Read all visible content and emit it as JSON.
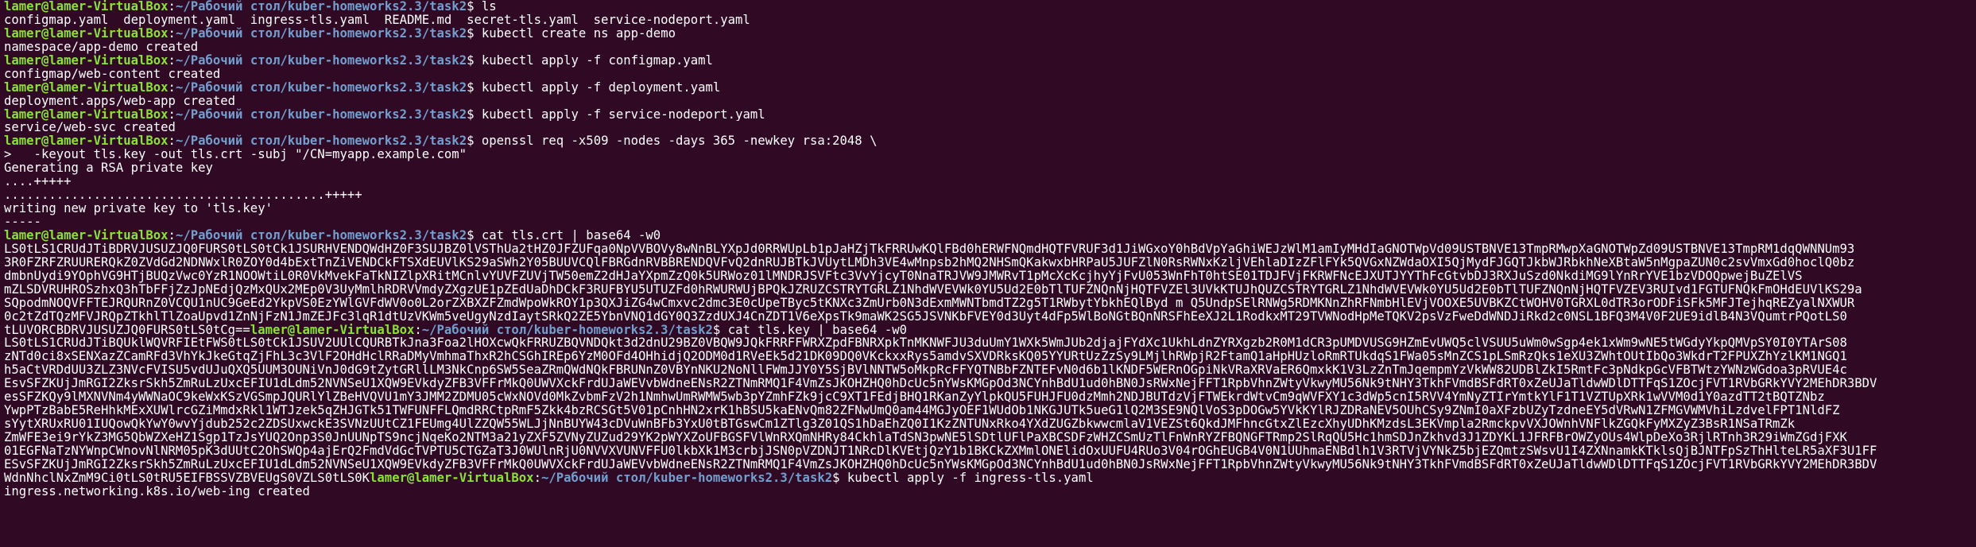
{
  "prompt": {
    "user": "lamer@lamer-VirtualBox",
    "path": "~/Рабочий стол/kuber-homeworks2.3/task2",
    "symbol": "$ "
  },
  "lines": [
    {
      "cmd": "ls"
    },
    {
      "out": "configmap.yaml  deployment.yaml  ingress-tls.yaml  README.md  secret-tls.yaml  service-nodeport.yaml"
    },
    {
      "cmd": "kubectl create ns app-demo"
    },
    {
      "out": "namespace/app-demo created"
    },
    {
      "cmd": "kubectl apply -f configmap.yaml"
    },
    {
      "out": "configmap/web-content created"
    },
    {
      "cmd": "kubectl apply -f deployment.yaml"
    },
    {
      "out": "deployment.apps/web-app created"
    },
    {
      "cmd": "kubectl apply -f service-nodeport.yaml"
    },
    {
      "out": "service/web-svc created"
    },
    {
      "cmd": "openssl req -x509 -nodes -days 365 -newkey rsa:2048 \\"
    },
    {
      "out": ">   -keyout tls.key -out tls.crt -subj \"/CN=myapp.example.com\""
    },
    {
      "out": "Generating a RSA private key"
    },
    {
      "out": "....+++++"
    },
    {
      "out": "...........................................+++++"
    },
    {
      "out": "writing new private key to 'tls.key'"
    },
    {
      "out": "-----"
    },
    {
      "cmd": "cat tls.crt | base64 -w0"
    },
    {
      "out": "LS0tLS1CRUdJTiBDRVJUSUZJQ0FURS0tLS0tCk1JSURHVENDQWdHZ0F3SUJBZ0lVSThUa2tHZ0JFZUFqa0NpVVBOVy8wNnBLYXpJd0RRWUpLb1pJaHZjTkFRRUwKQlFBd0hERWFNQmdHQTFVRUF3d1JiWGxoY0hBdVpYaGhiWEJzWlM1amIyMHdIaGNOTWpVd09USTBNVE13TmpRMwpXaGNOTWpZd09USTBNVE13TmpRM1dqQWNNUm93"
    },
    {
      "out": "3R0FZRFZRUURERQkZ0ZVdGd2NDNWxlR0ZOY0d4bExtTnZiVENDCkFTSXdEUVlKS29aSWh2Y05BUUVCQlFBRGdnRVBBRENDQVFvQ2dnRUJBTkJVUytLMDh3VE4wMnpsb2hMQ2NHSmQKakwxbHRPaU5JUFZlN0RsRWNxKzljVEhlaDIzZFlFYk5QVGxNZWdaOXI5QjMydFJGQTJkbWJRbkhNeXBtaW5nMgpaZUN0c2svVmxGd0hoclQ0bz"
    },
    {
      "out": "dmbnUydi9YOphVG9HTjBUQzVwc0YzR1NOOWtiL0R0VkMvekFaTkNIZlpXRitMCnlvYUVFZUVjTW50emZ2dHJaYXpmZzQ0k5URWoz01lMNDRJSVFtc3VvYjcyT0NnaTRJVW9JMWRvT1pMcXcKcjhyYjFvU053WnFhT0htSE01TDJFVjFKRWFNcEJXUTJYYThFcGtvbDJ3RXJuSzd0NkdiMG9lYnRrYVE1bzVDOQpwejBuZElVS"
    },
    {
      "out": "mZLSDVRUHROSzhxQ3hTbFFjZzJpNEdjQzMxQUx2MEp0V3UyMmlhRDRVVmdyZXgzUE1pZEdUaDhDCkF3RUFBYU5UTUZFd0hRWURWUjBPQkJZRUZCSTRYTGRLZ1NhdWVEVWk0YU5Ud2E0bTlTUFZNQnNjHQTFVZEl3UVkKTUJhQUZCSTRYTGRLZ1NhdWVEVWk0YU5Ud2E0bTlTUFZNQnNjHQTFVZEV3RUIvd1FGTUFNQkFmOHdEUVlKS29a"
    },
    {
      "out": "SQpodmNOQVFFTEJRQURnZ0VCQU1nUC9GeEd2YkpVS0EzYWlGVFdWV0o0L2orZXBXZFZmdWpoWkROY1p3QXJiZG4wCmxvc2dmc3E0cUpeTByc5tKNXc3ZmUrb0N3dExmMWNTbmdTZ2g5T1RWbytYbkhEQlByd m Q5UndpSElRNWg5RDMKNnZhRFNmbHlEVjVOOXE5UVBKZCtWOHV0TGRXL0dTR3orODFiSFk5MFJTejhqREZyalNXWUR"
    },
    {
      "out": "0c2tZdTQzMFVJRQpZTkhlTlZoaUpvd1ZnNjFzN1JmZEJFc3lqR1dtUzVKWm5veUgyNzdIaytSRkQ2ZE5YbnVNQ1dGY0Q3ZzdUXJ4CnZDT1V6eXpsTk9maWK2SG5JSVNKbFVEY0d3Uyt4dFp5WlBoNGtBQnNRSFhEeXJ2L1RodkxMT29TVWNodHpMeTQKV2psVzFweDdWNDJiRkd2c0NSL1BFQ3M4V0F2UE9idlB4N3VQumtrPQotLS0"
    },
    {
      "out": "tLUVORCBDRVJUSUZJQ0FURS0tLS0tCg==",
      "prompt_after": true
    },
    {
      "cmd_inline": "cat tls.key | base64 -w0"
    },
    {
      "out": "LS0tLS1CRUdJTiBQUklWQVRFIEtFWS0tLS0tCk1JSUV2UUlCQURBTkJna3Foa2lHOXcwQkFRRUZBQVNDQkt3d2dnU29BZ0VBQW9JQkFRRFFWRXZpdFBNRXpkTnMKNWFJU3duUmY1WXk5WmJUb2djajFYdXc1UkhLdnZYRXgzb2R0M1dCR3pUMDVUSG9HZmEvUWQ5clVSUU5uWm0wSgp4ek1xWm9wNE5tWGdyYkpQMVpSY0I0YTArS08"
    },
    {
      "out": "zNTd0ci8xSENXazZCamRFd3VhYkJkeGtqZjFhL3c3VlF2OHdHclRRaDMyVmhmaThxR2hCSGhIREp6YzM0OFd4OHhidjQ2ODM0d1RVeEk5d21DK09DQ0VKckxxRys5amdvSXVDRksKQ05YYURtUzZzSy9LMjlhRWpjR2FtamQ1aHpHUzloRmRTUkdqS1FWa05sMnZCS1pLSmRzQks1eXU3ZWhtOUtIbQo3WkdrT2FPUXZhYzlKM1NGQ1"
    },
    {
      "out": "h5aCtVRDdUU3ZLZ3NVcFVISU5vdUJuQXQ5UUM3OUNiVnJ0dG9tZytGRllLM3NkCnp6SW5SeaZRmQWdNQkFBRUNnZ0VBYnNKU2NoNllFWmJJY0Y5SjBVlNNTW5oMkpRcFFYQTNBbFZNTEFvN0d6b1lKNDF5WERnOGpiNkVRaXRVaER6QmxkK1V3LzZnTmJqempmYzVkWW82UDBlZkI5RmtFc3pNdkpGcVFBTWtzYWNzWGdoa3pRVUE4c"
    },
    {
      "out": "EsvSFZKUjJmRGI2ZksrSkh5ZmRuLzUxcEFIU1dLdm52NVNSeU1XQW9EVkdyZFB3VFFrMkQ0UWVXckFrdUJaWEVvbWdneENsR2ZTNmRMQ1F4VmZsJKOHZHQ0hDcUc5nYWsKMGpOd3NCYnhBdU1ud0hBN0JsRWxNejFFT1RpbVhnZWtyVkwyMU56Nk9tNHY3TkhFVmdBSFdRT0xZeUJaTldwWDlDTTFqS1ZOcjFVT1RVbGRkYVY2MEhDR3BDV"
    },
    {
      "out": "esSFZKQy9lMXNVNm4yWWNaOC9keWxKSzVGSmpJQURlYlZBeHVQVU1mY3JMM2ZDMU05cWxNOVd0MkZvbmFzV2h1NmhwUmRWMW5wb3pYZmhFZk9jcC9XT1FEdjBHQ1RKanZyYlpkQU5FUHJFU0dzMmh2NDJBUTdzVjFTWEkrdWtvCm9qWVFXY1c3dWp5cnI5RVV4YmNyZTIrYmtkYlF1T1VZTUpXRk1wVVM0d1Y0azdTT2tBQTZNbz"
    },
    {
      "out": "YwpPTzBabE5ReHhkMExXUWlrcGZiMmdxRkl1WTJzek5qZHJGTk51TWFUNFFLQmdRRCtpRmF5Zkk4bzRCSGt5V01pCnhHN2xrK1hBSU5kaENvQm82ZFNwUmQ0am44MGJyOEF1WUdOb1NKGJUTk5ueG1lQ2M3SE9NQlVoS3pDOGw5YVkKYlRJZDRaNEV5OUhCSy9ZNmI0aXFzbUZyTzdneEY5dVRwN1ZFMGVWMVhiLzdvelFPT1NldFZ"
    },
    {
      "out": "sYytXRUxRU01IUQowQkYwY0wvYjdub252c2ZDSUxwckE3SVNzUUtCZ1FEUmg4UlZZQW55WLJjNnBUYW43cDVuWnBFb3YxU0tBTGswCm1ZTlg3Z01QS1hDaEhZQ0I1KzZNTUNxRko4YXdZUGZbkwwcmlaV1VEZSt6QkdJMFhncGtxZlEzcXhyUDhKMzdsL3EKVmpla2RmckpvVXJOWnhVNFlkZGQkFyMXZyZ3BsR1NSaTRmZk"
    },
    {
      "out": "ZmWFE3ei9rYkZ3MG5QbWZXeHZ1Sgp1TzJsYUQ2Onp3S0JnUUNpTS9ncjNqeKo2NTM3a21yZXF5ZVNyZUZud29YK2pWYXZoUFBGSFVlWnRXQmNHRy84CkhlaTdSN3pwNE5lSDtlUFlPaXBCSDFzWHZCSmUzTlFnWnRYZFBQNGFTRmp2SlRqQU5Hc1hmSDJnZkhvd3J1ZDYKL1JFRFBrOWZyOUs4WlpDeXo3RjlRTnh3R29iWmZGdjFXK"
    },
    {
      "out": "01EGFNaTzNYWnpCWnovNlNRM05pK3dUUtC2OhSWQp4ajErQ2FmdVdGcTVPTU5CTGZaT3J0WUlnRjU0NVVXVUNVFFU0lkbXk1M3crbjJSN0pVZDNJT1NRcDlKVEtjQzY1b1BKCkZXMmlONElidOxUUFU4RUo3V04rOGhEUGB4V0N1UUhmaENBdlh1V3RTVjVYNkZ5bjEZQmtzSWsvU1I4ZXNnamkKTklsQjBJNTFpSzThHlteLR5aXF3U1FF"
    },
    {
      "out": "ESvSFZKUjJmRGI2ZksrSkh5ZmRuLzUxcEFIU1dLdm52NVNSeU1XQW9EVkdyZFB3VFFrMkQ0UWVXckFrdUJaWEVvbWdneENsR2ZTNmRMQ1F4VmZsJKOHZHQ0hDcUc5nYWsKMGpOd3NCYnhBdU1ud0hBN0JsRWxNejFFT1RpbVhnZWtyVkwyMU56Nk9tNHY3TkhFVmdBSFdRT0xZeUJaTldwWDlDTTFqS1ZOcjFVT1RVbGRkYVY2MEhDR3BDV"
    },
    {
      "out": "WdnNhclNxZmM9Ci0tLS0tRU5EIFBSSVZBVEUgS0VZLS0tLS0K",
      "prompt_after": true
    },
    {
      "cmd_inline": "kubectl apply -f ingress-tls.yaml"
    },
    {
      "out": "ingress.networking.k8s.io/web-ing created"
    }
  ]
}
